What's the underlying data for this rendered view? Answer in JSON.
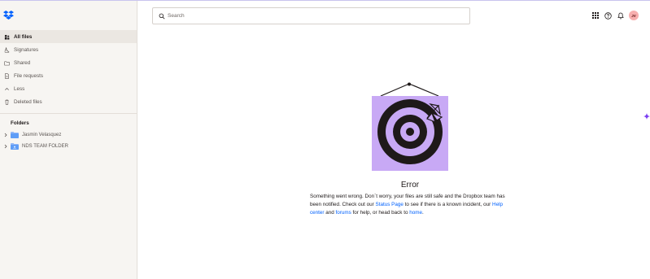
{
  "sidebar": {
    "items": [
      {
        "label": "All files",
        "icon": "all-files-icon",
        "active": true
      },
      {
        "label": "Signatures",
        "icon": "signature-icon",
        "active": false
      },
      {
        "label": "Shared",
        "icon": "shared-icon",
        "active": false
      },
      {
        "label": "File requests",
        "icon": "file-request-icon",
        "active": false
      },
      {
        "label": "Less",
        "icon": "chevron-up-icon",
        "active": false
      },
      {
        "label": "Deleted files",
        "icon": "trash-icon",
        "active": false
      }
    ],
    "folders_heading": "Folders",
    "folders": [
      {
        "label": "Jasmin Velasquez"
      },
      {
        "label": "NDS TEAM FOLDER"
      }
    ]
  },
  "header": {
    "search_placeholder": "Search",
    "avatar_initials": "JV"
  },
  "error": {
    "title": "Error",
    "text1": "Something went wrong. Don`t worry, your files are still safe and the Dropbox team has been notified. Check out our ",
    "status_link": "Status Page",
    "text2": " to see if there is a known incident, our ",
    "help_link": "Help center",
    "text3": " and ",
    "forums_link": "forums",
    "text4": " for help, or head back to ",
    "home_link": "home",
    "text5": "."
  },
  "colors": {
    "accent": "#0061fe",
    "illustration_bg": "#c8a9f5",
    "sidebar_bg": "#f7f5f2",
    "avatar_bg": "#f7aeae"
  }
}
